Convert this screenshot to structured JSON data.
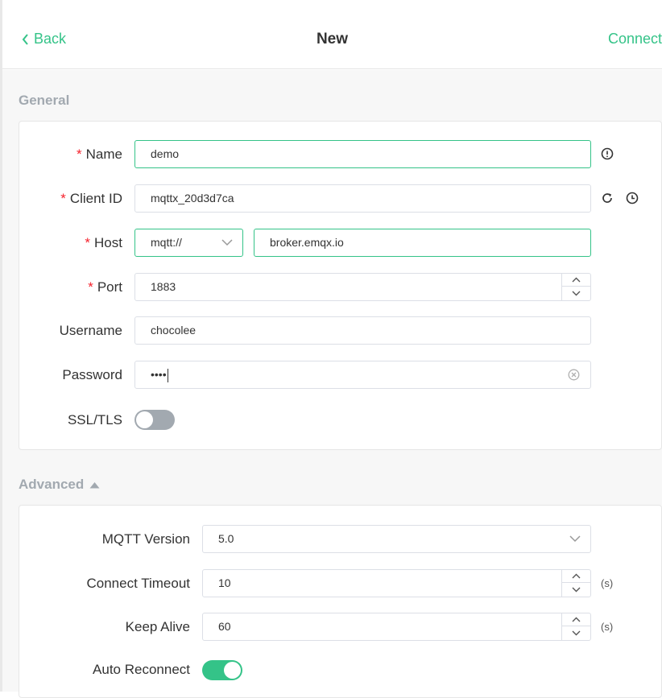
{
  "header": {
    "back_label": "Back",
    "title": "New",
    "connect_label": "Connect"
  },
  "general": {
    "title": "General",
    "name": {
      "label": "Name",
      "value": "demo",
      "required": true
    },
    "client_id": {
      "label": "Client ID",
      "value": "mqttx_20d3d7ca",
      "required": true
    },
    "host": {
      "label": "Host",
      "protocol": "mqtt://",
      "value": "broker.emqx.io",
      "required": true
    },
    "port": {
      "label": "Port",
      "value": "1883",
      "required": true
    },
    "username": {
      "label": "Username",
      "value": "chocolee"
    },
    "password": {
      "label": "Password",
      "value": "••••"
    },
    "ssl_tls": {
      "label": "SSL/TLS",
      "enabled": false
    }
  },
  "advanced": {
    "title": "Advanced",
    "mqtt_version": {
      "label": "MQTT Version",
      "value": "5.0"
    },
    "connect_timeout": {
      "label": "Connect Timeout",
      "value": "10",
      "unit": "(s)"
    },
    "keep_alive": {
      "label": "Keep Alive",
      "value": "60",
      "unit": "(s)"
    },
    "auto_reconnect": {
      "label": "Auto Reconnect",
      "enabled": true
    }
  },
  "colors": {
    "accent": "#34c388",
    "required": "#f5222d",
    "toggle_off": "#a2a9b0",
    "section_title": "#a2a9b0"
  },
  "icons": {
    "back": "chevron-left-icon",
    "name_info": "exclamation-circle-icon",
    "refresh": "refresh-icon",
    "history": "clock-icon",
    "clear": "clear-circle-icon",
    "select": "chevron-down-icon",
    "collapse": "caret-up-icon"
  }
}
